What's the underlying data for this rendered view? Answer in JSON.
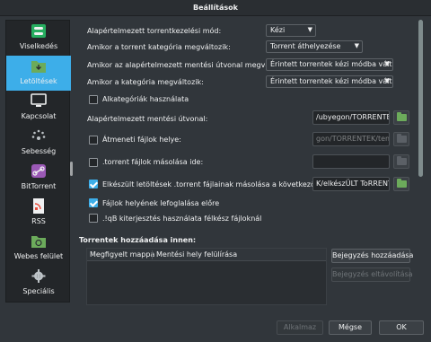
{
  "window": {
    "title": "Beállítások"
  },
  "sidebar": {
    "items": [
      {
        "label": "Viselkedés",
        "icon": "toggle-icon",
        "active": false
      },
      {
        "label": "Letöltések",
        "icon": "folder-download-icon",
        "active": true
      },
      {
        "label": "Kapcsolat",
        "icon": "monitor-icon",
        "active": false
      },
      {
        "label": "Sebesség",
        "icon": "speed-icon",
        "active": false
      },
      {
        "label": "BitTorrent",
        "icon": "bittorrent-icon",
        "active": false
      },
      {
        "label": "RSS",
        "icon": "rss-icon",
        "active": false
      },
      {
        "label": "Webes felület",
        "icon": "web-ui-icon",
        "active": false
      },
      {
        "label": "Speciális",
        "icon": "gear-icon",
        "active": false
      }
    ]
  },
  "downloads": {
    "mode_label": "Alapértelmezett torrentkezelési mód:",
    "mode_value": "Kézi",
    "category_change_label": "Amikor a torrent kategória megváltozik:",
    "category_change_value": "Torrent áthelyezése",
    "default_path_change_label": "Amikor az alapértelmezett mentési útvonal megváltozik:",
    "default_path_change_value": "Érintett torrentek kézi módba váltász",
    "category_path_change_label": "Amikor a kategória megváltozik:",
    "category_path_change_value": "Érintett torrentek kézi módba váltász",
    "use_subcategories_label": "Alkategóriák használata",
    "use_subcategories_checked": false,
    "default_save_path_label": "Alapértelmezett mentési útvonal:",
    "default_save_path_value": "/ubyegon/TORRENTEK/",
    "temp_path_label": "Átmeneti fájlok helye:",
    "temp_path_checked": false,
    "temp_path_value": "gon/TORRENTEK/temp/",
    "copy_torrent_label": ".torrent fájlok másolása ide:",
    "copy_torrent_checked": false,
    "copy_torrent_value": "",
    "copy_finished_label": "Elkészült letöltések .torrent fájlainak másolása a következő helyre:",
    "copy_finished_checked": true,
    "copy_finished_value": "K/elkészÜLT ToRRENTEK",
    "preallocate_label": "Fájlok helyének lefoglalása előre",
    "preallocate_checked": true,
    "incomplete_ext_label": ".!qB kiterjesztés használata félkész fájloknál",
    "incomplete_ext_checked": false
  },
  "watched": {
    "section_title": "Torrentek hozzáadása innen:",
    "columns": [
      "Megfigyelt mappa",
      "Mentési hely felülírása"
    ],
    "add_entry_label": "Bejegyzés hozzáadása",
    "remove_entry_label": "Bejegyzés eltávolítása"
  },
  "footer": {
    "apply_label": "Alkalmaz",
    "cancel_label": "Mégse",
    "ok_label": "OK"
  }
}
